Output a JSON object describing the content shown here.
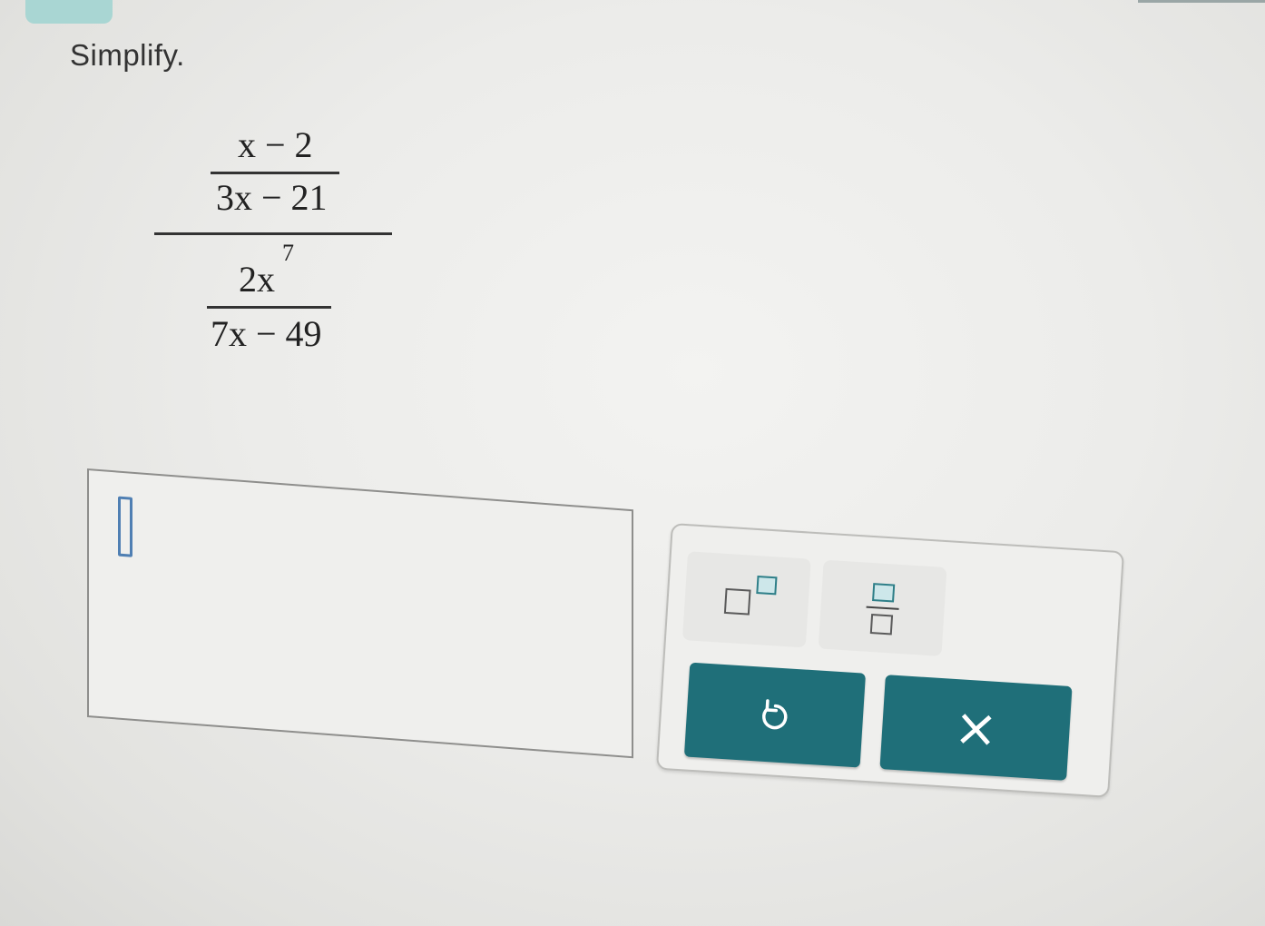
{
  "instruction": "Simplify.",
  "expression": {
    "top_numerator": "x − 2",
    "top_denominator": "3x − 21",
    "bottom_numerator_base": "2x",
    "bottom_numerator_exponent": "7",
    "bottom_denominator": "7x − 49"
  },
  "answer": {
    "value": ""
  },
  "keypad": {
    "keys": [
      {
        "name": "exponent",
        "icon": "superscript-template-icon"
      },
      {
        "name": "fraction",
        "icon": "fraction-template-icon"
      }
    ],
    "undo_icon": "undo-icon",
    "clear_label": "×"
  },
  "colors": {
    "action_button": "#1f6f79",
    "placeholder_accent": "#2f7f88",
    "cursor": "#4f7fb3",
    "tab": "#a9d6d3"
  }
}
